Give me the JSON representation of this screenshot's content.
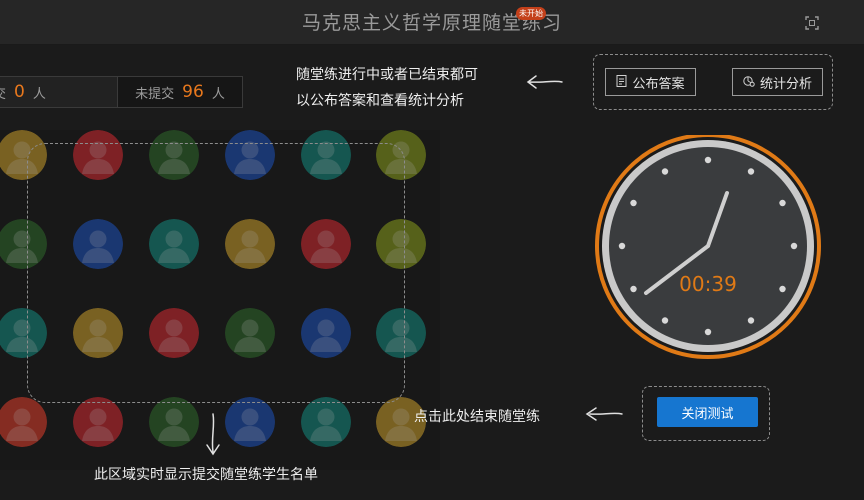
{
  "header": {
    "title": "马克思主义哲学原理随堂练习",
    "status_badge": "未开始",
    "fullscreen_icon": "fullscreen-icon"
  },
  "counter": {
    "submitted_label": "交",
    "submitted_count": "0",
    "submitted_unit": "人",
    "unsubmitted_label": "未提交",
    "unsubmitted_count": "96",
    "unsubmitted_unit": "人"
  },
  "actions": {
    "publish_answer": "公布答案",
    "statistics": "统计分析",
    "publish_icon": "document-icon",
    "statistics_icon": "chart-icon"
  },
  "tips": {
    "answer_line1": "随堂练进行中或者已结束都可",
    "answer_line2": "以公布答案和查看统计分析",
    "end_tip": "点击此处结束随堂练",
    "list_tip": "此区域实时显示提交随堂练学生名单"
  },
  "clock": {
    "time": "00:39",
    "ring_color": "#e07a16",
    "face_color": "#3a3c3e"
  },
  "close_button": "关闭测试",
  "avatar_palette": [
    "#b08a2a",
    "#b7282f",
    "#2d5e2a",
    "#1e4aa3",
    "#167a70",
    "#7a8a1e",
    "#c23a2a"
  ],
  "colors": {
    "accent": "#e8781d",
    "primary_button": "#1676d0",
    "background": "#1b1b1b"
  }
}
